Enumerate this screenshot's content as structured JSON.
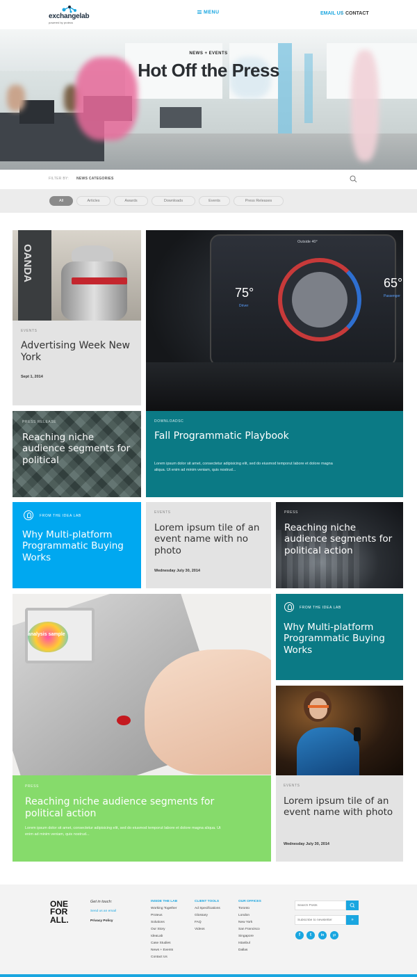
{
  "header": {
    "logo_text": "exchangelab",
    "logo_sub": "powered by proteus",
    "menu_label": "MENU",
    "email_label": "EMAIL US",
    "separator": "/",
    "contact_label": "CONTACT"
  },
  "hero": {
    "eyebrow": "NEWS + EVENTS",
    "title": "Hot Off the Press"
  },
  "filter": {
    "label": "FILTER BY:",
    "value": "NEWS CATEGORIES",
    "chips": [
      "All",
      "Articles",
      "Awards",
      "Downloads",
      "Events",
      "Press Releases"
    ],
    "active_chip": "All"
  },
  "tiles": {
    "t1": {
      "eyebrow": "EVENTS",
      "title": "Advertising Week New York",
      "date": "Sept 1, 2014"
    },
    "t2": {
      "eyebrow": "PRESS RELEASE",
      "title": "Reaching niche audience segments for political"
    },
    "t3": {
      "eyebrow": "DOWNLOADSC",
      "title": "Fall Programmatic Playbook",
      "body": "Lorem ipsum dolor sit amet, consectetur adipisicing elit, sed do eiusmod temporut labore et dolore magna aliqua. Ut enim ad minim veniam, quis nostrud..."
    },
    "t4": {
      "eyebrow": "FROM THE IDEA LAB",
      "title": "Why Multi-platform Programmatic Buying Works"
    },
    "t5": {
      "eyebrow": "EVENTS",
      "title": "Lorem ipsum tile of an event name with no photo",
      "date": "Wednesday July 30, 2014"
    },
    "t6": {
      "eyebrow": "PRESS",
      "title": "Reaching niche audience segments for political action"
    },
    "t7": {
      "eyebrow": "FROM THE IDEA LAB",
      "title": "Why Multi-platform Programmatic Buying Works"
    },
    "t8": {
      "eyebrow": "PRESS",
      "title": "Reaching niche audience segments for political action",
      "body": "Lorem ipsum dolor sit amet, consectetur adipisicing elit, sed do eiusmod temporut labore et dolore magna aliqua. Ut enim ad minim veniam, quis nostrud..."
    },
    "t9": {
      "eyebrow": "EVENTS",
      "title": "Lorem ipsum tile of an event name with photo",
      "date": "Wednesday July 30, 2014"
    }
  },
  "car_display": {
    "outside": "Outside 40°",
    "left_temp": "75°",
    "left_label": "Driver",
    "right_temp": "65°",
    "right_label": "Passenger"
  },
  "badge_text": "OANDA",
  "sample_text": "analysis sample",
  "footer": {
    "brand": [
      "ONE",
      "FOR",
      "ALL."
    ],
    "get_in_touch": "Get in touch:",
    "send_email": "Send us an email",
    "privacy": "Privacy Policy",
    "col1": {
      "head": "INSIDE THE LAB",
      "items": [
        "Working Together",
        "Proteus",
        "Solutions",
        "Our Story",
        "IdeaLab",
        "Case Studies",
        "News + Events",
        "Contact Us"
      ]
    },
    "col2": {
      "head": "CLIENT TOOLS",
      "items": [
        "Ad Specifications",
        "Glossary",
        "FAQ",
        "Videos"
      ]
    },
    "col3": {
      "head": "OUR OFFICES",
      "items": [
        "Toronto",
        "London",
        "New York",
        "San Francisco",
        "Singapore",
        "Istanbul",
        "Dallas"
      ]
    },
    "search_placeholder": "Search Posts",
    "newsletter_placeholder": "Subscribe to newsletter",
    "socials": [
      "f",
      "t",
      "in",
      "yt"
    ]
  },
  "colors": {
    "accent": "#1aa6e0",
    "teal": "#0b7a85",
    "blue": "#00a8f0",
    "green": "#86db6b",
    "gray_tile": "#e3e3e3"
  }
}
